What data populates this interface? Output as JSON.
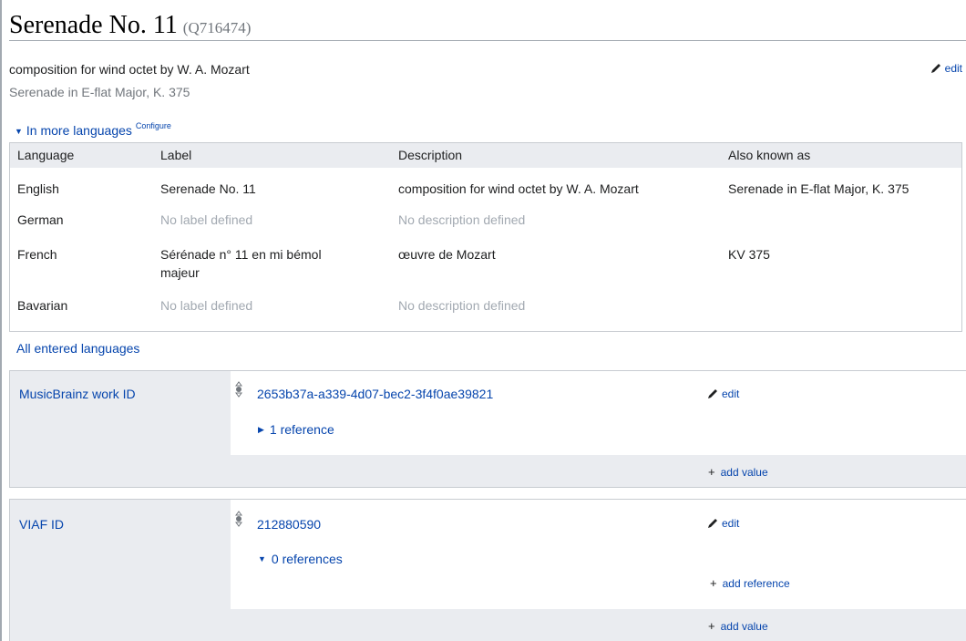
{
  "header": {
    "title": "Serenade No. 11",
    "qid": "(Q716474)"
  },
  "description": "composition for wind octet by W. A. Mozart",
  "alias": "Serenade in E-flat Major, K. 375",
  "edit_label": "edit",
  "more_languages": {
    "toggle_label": "In more languages",
    "configure_label": "Configure"
  },
  "lang_table": {
    "headers": {
      "language": "Language",
      "label": "Label",
      "description": "Description",
      "aliases": "Also known as"
    },
    "rows": [
      {
        "language": "English",
        "label": "Serenade No. 11",
        "description": "composition for wind octet by W. A. Mozart",
        "aliases": "Serenade in E-flat Major, K. 375"
      },
      {
        "language": "German",
        "label": "No label defined",
        "description": "No description defined",
        "aliases": ""
      },
      {
        "language": "French",
        "label_line1": "Sérénade n° 11 en mi bémol",
        "label_line2": "majeur",
        "description": "œuvre de Mozart",
        "aliases": "KV 375"
      },
      {
        "language": "Bavarian",
        "label": "No label defined",
        "description": "No description defined",
        "aliases": ""
      }
    ]
  },
  "all_languages_label": "All entered languages",
  "statements": [
    {
      "property": "MusicBrainz work ID",
      "value": "2653b37a-a339-4d07-bec2-3f4f0ae39821",
      "references": "1 reference",
      "add_value": "add value"
    },
    {
      "property": "VIAF ID",
      "value": "212880590",
      "references": "0 references",
      "add_reference": "add reference",
      "add_value": "add value"
    }
  ],
  "colors": {
    "link": "#0645ad",
    "muted": "#a2a9b1",
    "header_bg": "#eaecf0",
    "border": "#c8ccd1"
  },
  "icons": {
    "edit": "pencil-icon",
    "rank": "normal-rank-icon",
    "collapsed": "triangle-right-icon",
    "expanded": "triangle-down-icon",
    "add": "plus-icon"
  }
}
